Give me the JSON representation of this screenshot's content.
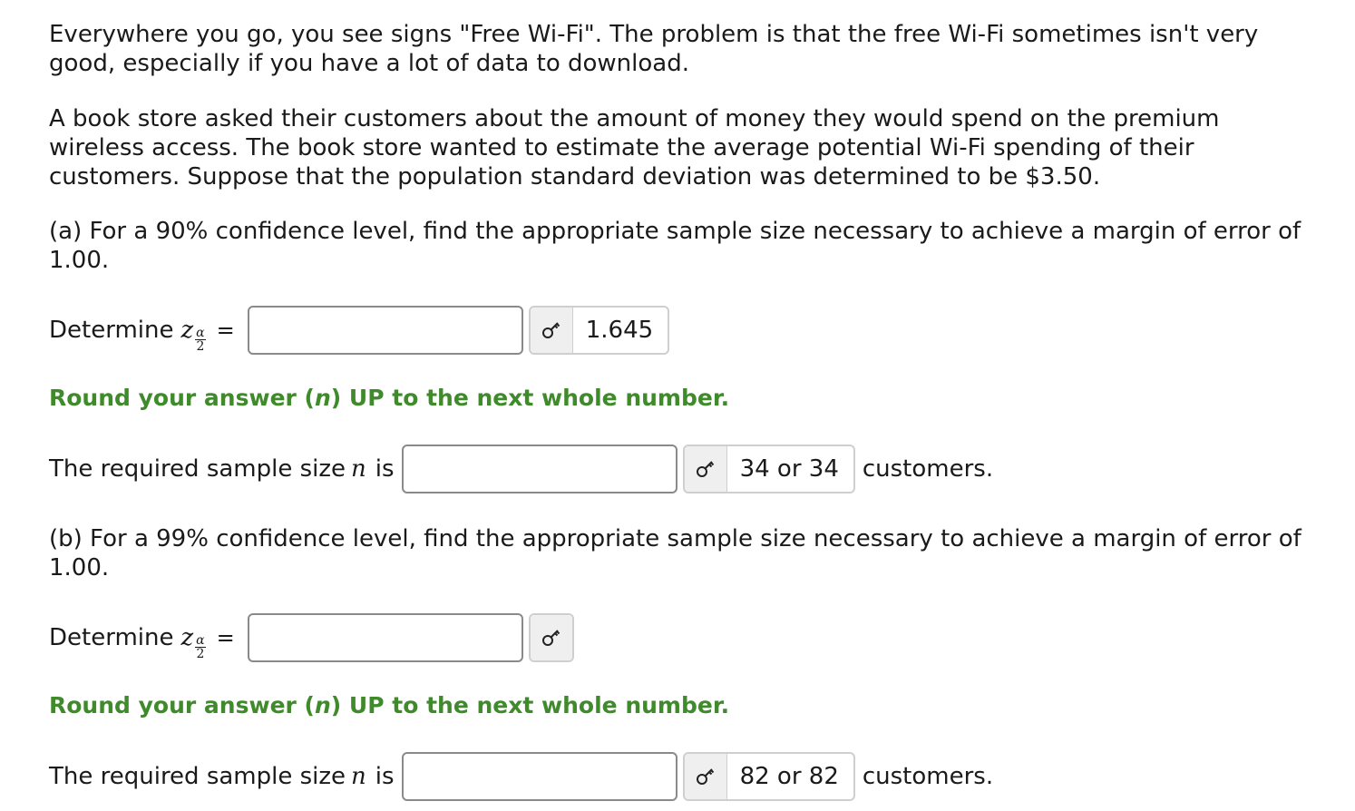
{
  "intro": {
    "p1": "Everywhere you go, you see signs \"Free Wi-Fi\". The problem is that the free Wi-Fi sometimes isn't very good, especially if you have a lot of data to download.",
    "p2": "A book store asked their customers about the amount of money they would spend on the premium wireless access. The book store wanted to estimate the average potential Wi-Fi spending of their customers. Suppose that the population standard deviation was determined to be $3.50."
  },
  "part_a": {
    "question": "(a) For a 90% confidence level, find the appropriate sample size necessary to achieve a margin of error of 1.00.",
    "z_label": "Determine",
    "z_symbol": "z",
    "z_sub_num": "α",
    "z_sub_den": "2",
    "equals": "=",
    "z_input_value": "",
    "z_key_answer": "1.645",
    "hint_pre": "Round your answer (",
    "hint_n": "n",
    "hint_post": ") UP to the next whole number.",
    "n_label": "The required sample size",
    "n_symbol": "n",
    "n_is": "is",
    "n_input_value": "",
    "n_key_answer": "34 or 34",
    "n_suffix": "customers."
  },
  "part_b": {
    "question": "(b) For a 99% confidence level, find the appropriate sample size necessary to achieve a margin of error of 1.00.",
    "z_label": "Determine",
    "z_symbol": "z",
    "z_sub_num": "α",
    "z_sub_den": "2",
    "equals": "=",
    "z_input_value": "",
    "z_key_answer": "",
    "hint_pre": "Round your answer (",
    "hint_n": "n",
    "hint_post": ") UP to the next whole number.",
    "n_label": "The required sample size",
    "n_symbol": "n",
    "n_is": "is",
    "n_input_value": "",
    "n_key_answer": "82 or 82",
    "n_suffix": "customers."
  },
  "icons": {
    "answer_key": "key-icon"
  },
  "colors": {
    "hint_green": "#3f8a2a",
    "input_border": "#8a8a8a",
    "key_button_bg": "#efefef"
  }
}
